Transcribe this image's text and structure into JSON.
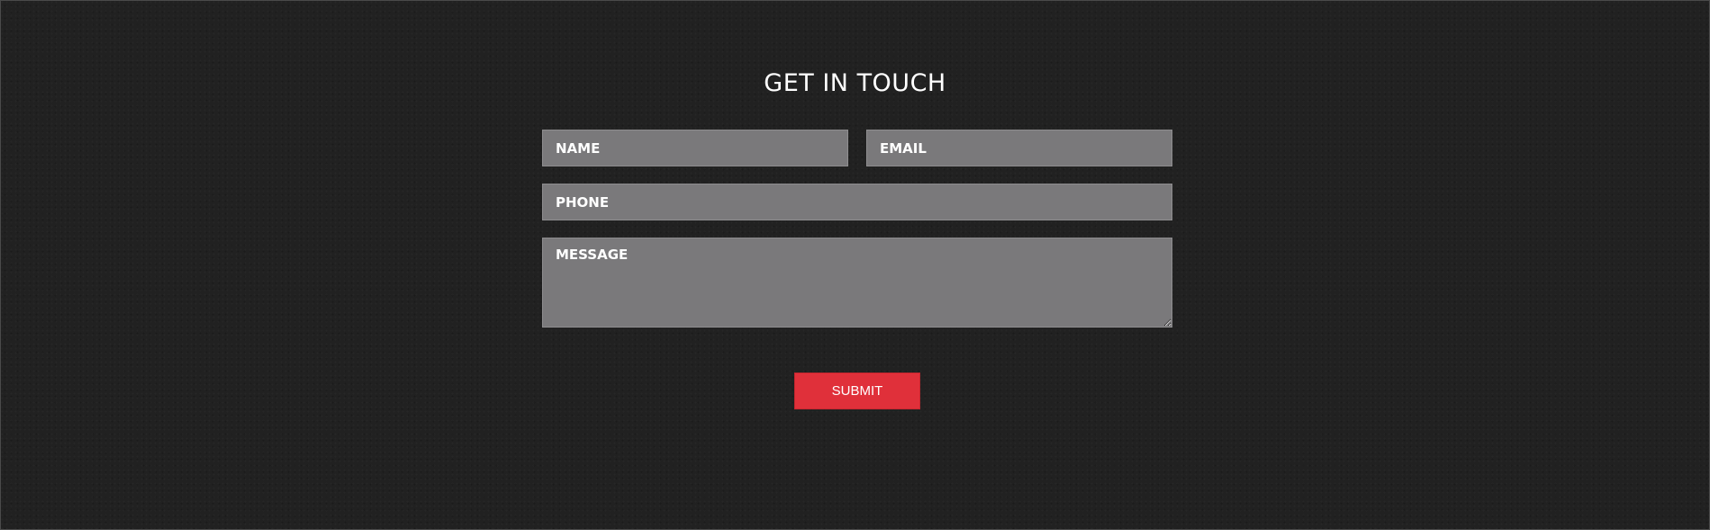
{
  "contact_form": {
    "title": "GET IN TOUCH",
    "name_placeholder": "NAME",
    "email_placeholder": "EMAIL",
    "phone_placeholder": "PHONE",
    "message_placeholder": "MESSAGE",
    "submit_label": "SUBMIT"
  },
  "colors": {
    "background": "#212121",
    "field_background": "#7a797b",
    "submit_background": "#e0303a",
    "text": "#ffffff"
  }
}
